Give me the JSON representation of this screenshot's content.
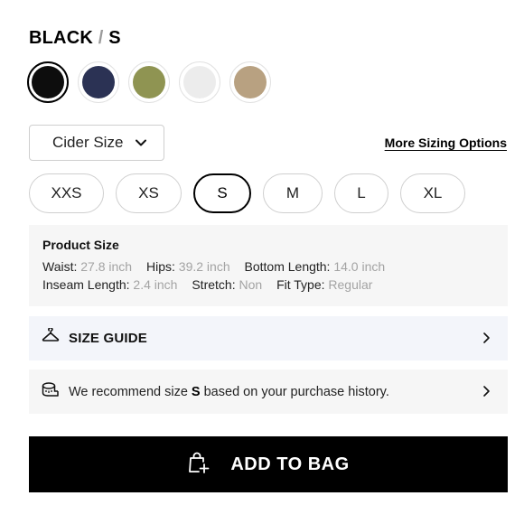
{
  "selection": {
    "color": "BLACK",
    "separator": "/",
    "size": "S"
  },
  "swatches": [
    {
      "name": "black",
      "color": "#0d0d0d",
      "selected": true
    },
    {
      "name": "navy",
      "color": "#2b3254",
      "selected": false
    },
    {
      "name": "olive",
      "color": "#8f9452",
      "selected": false
    },
    {
      "name": "white",
      "color": "#ececec",
      "selected": false
    },
    {
      "name": "khaki",
      "color": "#b8a181",
      "selected": false
    }
  ],
  "size_system": {
    "label": "Cider Size",
    "icon": "chevron-down-icon"
  },
  "more_sizing_label": "More Sizing Options",
  "sizes": [
    {
      "label": "XXS",
      "selected": false
    },
    {
      "label": "XS",
      "selected": false
    },
    {
      "label": "S",
      "selected": true
    },
    {
      "label": "M",
      "selected": false
    },
    {
      "label": "L",
      "selected": false
    },
    {
      "label": "XL",
      "selected": false
    }
  ],
  "product_size": {
    "title": "Product Size",
    "waist_label": "Waist:",
    "waist_value": "27.8 inch",
    "hips_label": "Hips:",
    "hips_value": "39.2 inch",
    "bottom_length_label": "Bottom Length:",
    "bottom_length_value": "14.0 inch",
    "inseam_label": "Inseam Length:",
    "inseam_value": "2.4 inch",
    "stretch_label": "Stretch:",
    "stretch_value": "Non",
    "fit_type_label": "Fit Type:",
    "fit_type_value": "Regular"
  },
  "size_guide": {
    "label": "SIZE GUIDE",
    "icon": "hanger-icon"
  },
  "recommendation": {
    "prefix": "We recommend size ",
    "size": "S",
    "suffix": " based on your purchase history.",
    "icon": "tape-measure-icon"
  },
  "add_to_bag": {
    "label": "ADD TO BAG",
    "icon": "shopping-bag-plus-icon"
  },
  "colors": {
    "accent": "#000000",
    "muted_text": "#a3a3a3",
    "guide_bg": "#f3f5fa",
    "panel_bg": "#f6f6f6"
  }
}
